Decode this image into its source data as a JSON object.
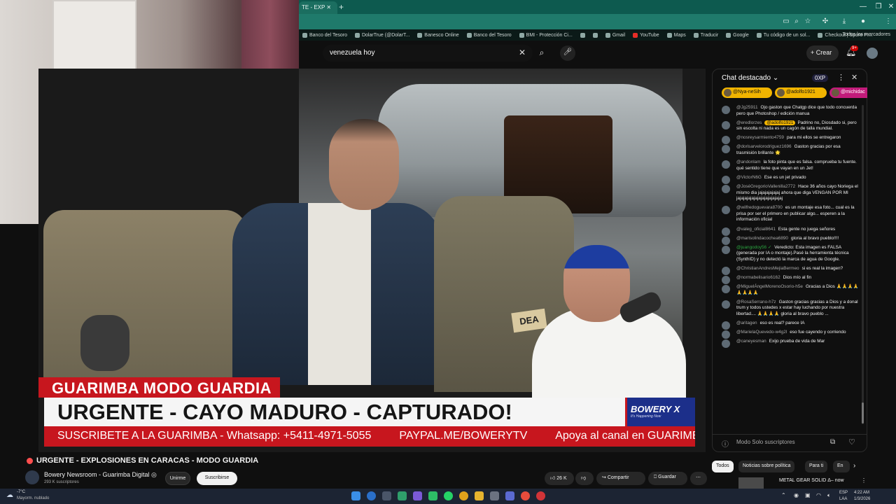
{
  "browser": {
    "tab_title": "TE - EXP",
    "new_tab_symbol": "+",
    "window_controls": [
      "—",
      "❐",
      "✕"
    ],
    "bookmarks": [
      "Banco del Tesoro",
      "DolarTrue (@DolarT...",
      "Banesco Online",
      "Banco del Tesoro",
      "BMI - Protección Ci...",
      "",
      "",
      "Gmail",
      "YouTube",
      "Maps",
      "Traducir",
      "Google",
      "Tu código de un sol...",
      "Checkout | Spore Pr..."
    ],
    "bookmarks_all": "Todos los marcadores"
  },
  "youtube": {
    "search_value": "venezuela hoy",
    "create_label": "Crear",
    "notif_count": "9+"
  },
  "webcam": {
    "label": ""
  },
  "overlay": {
    "red_label": "GUARIMBA MODO GUARDIA",
    "headline": "URGENTE - CAYO MADURO - CAPTURADO!",
    "brand": "BOWERY X",
    "brand_tag": "It's Happening Now",
    "ticker": [
      "SUSCRIBETE A LA GUARIMBA - Whatsapp: +5411-4971-5055",
      "PAYPAL.ME/BOWERYTV",
      "Apoya al canal en GUARIMBADIGITAL.COM"
    ],
    "patch": "DEA"
  },
  "chat": {
    "title": "Chat destacado",
    "xp": "0XP",
    "pinned": [
      "@Nya-neSih",
      "@adolfo1921",
      "@michidac"
    ],
    "messages": [
      {
        "author": "@Jg25911",
        "text": "Ojo gaston que Chatgp dice que todo concuerda pero que Photoshop / edición manua",
        "style": ""
      },
      {
        "author": "@eredlorzes",
        "highlight": "@adolfo1921",
        "text": "Padrino no, Diosdado si, pero sin escolta ni nada es un cagón de talla mundial.",
        "style": ""
      },
      {
        "author": "@nosreysarmiento4759",
        "text": "para mi ellos se entregaron",
        "style": ""
      },
      {
        "author": "@dorisarvelorodriguez1696",
        "text": "Gaston gracias por esa trasmisión brillante 🌟",
        "style": ""
      },
      {
        "author": "@andonlam",
        "text": "la foto pinta que es falsa. comprueba tu fuente. qué sentido tiene que vayan en un Jet!",
        "style": ""
      },
      {
        "author": "@VictorN6G",
        "text": "Ese es un jet privado",
        "style": ""
      },
      {
        "author": "@JoséGregorioVallenilla2772",
        "text": "Hace 36 años cayo Noriega el mismo dia jajajajajajaj ahora que diga VENGAN POR MI jajajajajajajajajajajajajaj",
        "style": ""
      },
      {
        "author": "@wilfredoguevara8700",
        "text": "es un montaje esa foto... cual es la prisa por ser el primero en publicar algo... esperen a la información oficial",
        "style": ""
      },
      {
        "author": "@valeg_oficial8641",
        "text": "Esta gente no juega señores",
        "style": ""
      },
      {
        "author": "@marisolindacochea6890",
        "text": "gloria al bravo pueblo!!!!",
        "style": ""
      },
      {
        "author": "@juangodoy56 ✓",
        "text": "Veredicto: Esta imagen es FALSA (generada por IA o montaje).Pasé la herramienta técnica (SynthID) y no detectó la marca de agua de Google.",
        "style": "green"
      },
      {
        "author": "@ChristianAndresMejiaBermeo",
        "text": "si es real la imagen?",
        "style": ""
      },
      {
        "author": "@normabelisario6162",
        "text": "Dios mío al fin",
        "style": ""
      },
      {
        "author": "@MiguelÁngelMorenoOsorio-h5e",
        "text": "Gracias a Dios 🙏🙏🙏🙏🙏🙏🙏🙏",
        "style": ""
      },
      {
        "author": "@RosaSerrano-h7z",
        "text": "Gaston gracias gracias a Dios y a donal trum y todos ustedes x estar hay luchando por nuestra libertad.... 🙏🙏🙏🙏 gloria al bravo pueblo ...",
        "style": ""
      },
      {
        "author": "@aritagen",
        "text": "eso es real? parece IA",
        "style": ""
      },
      {
        "author": "@MarielaQuevedo-w4g2l",
        "text": "eso fue cayendo y corriendo",
        "style": ""
      },
      {
        "author": "@caneyesman",
        "text": "Exijo prueba de vida de Mar",
        "style": ""
      }
    ],
    "footer_mode": "Modo Solo suscriptores"
  },
  "video": {
    "title": "URGENTE - EXPLOSIONES EN CARACAS - MODO GUARDIA",
    "channel": "Bowery Newsroom - Guarimba Digital ◎",
    "subs": "293 K suscriptores",
    "join": "Unirme",
    "subscribe": "Suscribirse",
    "likes": "26 K",
    "share": "Compartir",
    "save": "Guardar"
  },
  "sidebar_chips": [
    "Todos",
    "Noticias sobre política",
    "Para ti",
    "En"
  ],
  "recommended_title": "METAL GEAR SOLID Δ– now",
  "taskbar": {
    "temp": "-7°C",
    "weather": "Mayorm. nublado",
    "lang1": "ESP",
    "lang2": "LAA",
    "time": "4:22 AM",
    "date": "1/3/2026"
  },
  "colors": {
    "red": "#c7161e",
    "brand_blue": "#1c2f8a",
    "chrome_green": "#1f7a6b",
    "pill_yellow": "#f1b400"
  }
}
